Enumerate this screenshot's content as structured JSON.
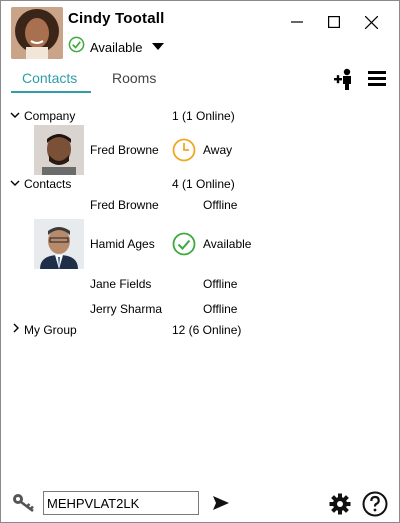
{
  "user": {
    "name": "Cindy Tootall",
    "status": "Available"
  },
  "tabs": [
    {
      "label": "Contacts",
      "active": true
    },
    {
      "label": "Rooms",
      "active": false
    }
  ],
  "groups": [
    {
      "name": "Company",
      "summary": "1 (1 Online)",
      "expanded": true
    },
    {
      "name": "Contacts",
      "summary": "4 (1 Online)",
      "expanded": true
    },
    {
      "name": "My Group",
      "summary": "12 (6 Online)",
      "expanded": false
    }
  ],
  "contacts": {
    "company_fred": {
      "name": "Fred Browne",
      "status": "Away"
    },
    "fred": {
      "name": "Fred Browne",
      "status": "Offline"
    },
    "hamid": {
      "name": "Hamid Ages",
      "status": "Available"
    },
    "jane": {
      "name": "Jane Fields",
      "status": "Offline"
    },
    "jerry": {
      "name": "Jerry Sharma",
      "status": "Offline"
    }
  },
  "footer": {
    "input_value": "MEHPVLAT2LK"
  },
  "colors": {
    "accent": "#2f9ea8",
    "available": "#3daa3d",
    "away": "#f0a820"
  },
  "icons": [
    "available-check-icon",
    "chevron-down-icon",
    "minimize-icon",
    "maximize-icon",
    "close-icon",
    "add-contact-icon",
    "menu-icon",
    "away-clock-icon",
    "key-icon",
    "send-icon",
    "settings-gear-icon",
    "help-icon"
  ]
}
